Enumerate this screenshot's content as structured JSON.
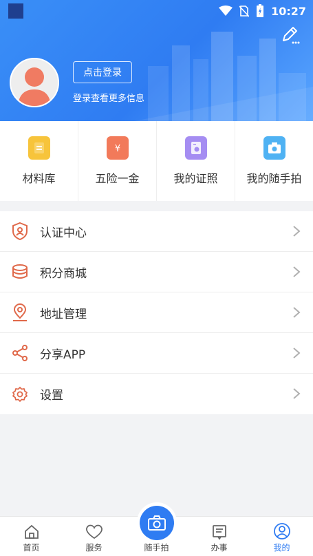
{
  "status_bar": {
    "time": "10:27"
  },
  "header": {
    "login_button": "点击登录",
    "login_hint": "登录查看更多信息",
    "edit_icon": "edit-icon"
  },
  "quick_grid": [
    {
      "label": "材料库",
      "icon": "document-icon",
      "color": "#f7c43b"
    },
    {
      "label": "五险一金",
      "icon": "wallet-icon",
      "color": "#f27a5a"
    },
    {
      "label": "我的证照",
      "icon": "license-icon",
      "color": "#a58df2"
    },
    {
      "label": "我的随手拍",
      "icon": "camera-icon",
      "color": "#4fb2f3"
    }
  ],
  "menu": [
    {
      "label": "认证中心",
      "icon": "shield-user-icon"
    },
    {
      "label": "积分商城",
      "icon": "coins-icon"
    },
    {
      "label": "地址管理",
      "icon": "location-icon"
    },
    {
      "label": "分享APP",
      "icon": "share-icon"
    },
    {
      "label": "设置",
      "icon": "gear-icon"
    }
  ],
  "nav": [
    {
      "label": "首页",
      "icon": "home-icon"
    },
    {
      "label": "服务",
      "icon": "heart-icon"
    },
    {
      "label": "随手拍",
      "icon": "camera-icon"
    },
    {
      "label": "办事",
      "icon": "task-icon"
    },
    {
      "label": "我的",
      "icon": "user-icon",
      "active": true
    }
  ],
  "colors": {
    "primary": "#2f7cf2",
    "accent_icon": "#e0694a"
  }
}
